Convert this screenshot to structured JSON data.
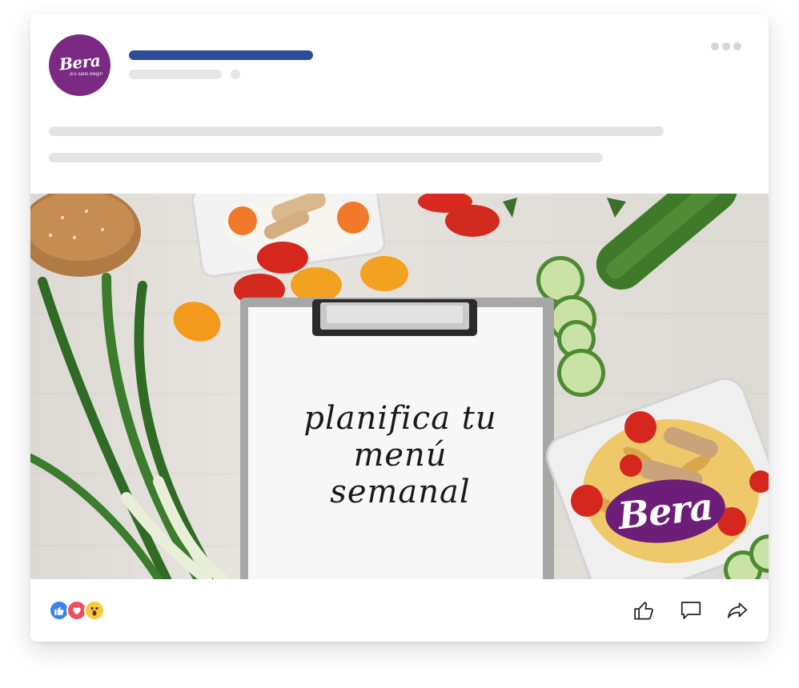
{
  "post": {
    "avatar": {
      "brand": "Bera",
      "tagline": "¡Es sano elegir!"
    },
    "image": {
      "headline": "planifica tu\nmenú\nsemanal",
      "logo_text": "Bera"
    },
    "reactions": [
      "like-icon",
      "love-icon",
      "wow-icon"
    ],
    "actions": [
      "like-icon",
      "comment-icon",
      "share-icon"
    ]
  },
  "colors": {
    "brand_purple": "#7a2a82",
    "name_bar": "#2e4d97",
    "placeholder_gray": "#e4e4e4"
  }
}
